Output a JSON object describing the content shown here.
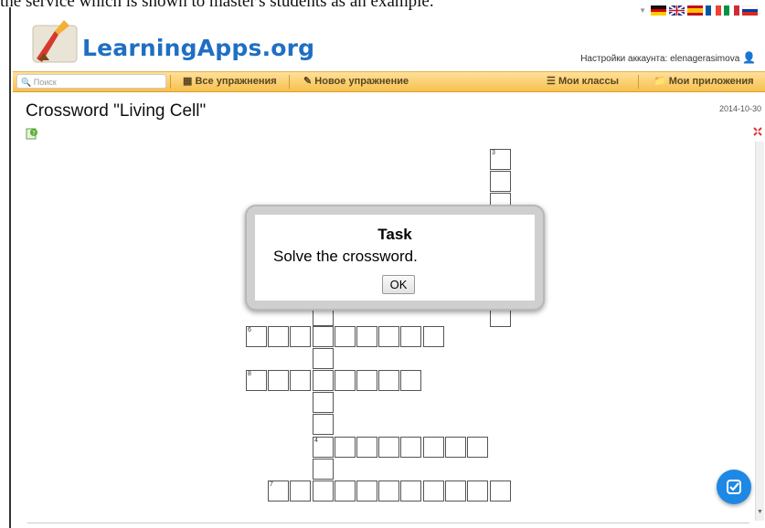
{
  "doc_text_above": "the service which is shown to master's students as an example.",
  "header": {
    "logo_text": "LearningApps.org",
    "account_label": "Настройки аккаунта: elenagerasimova"
  },
  "navbar": {
    "search_placeholder": "Поиск",
    "items": [
      {
        "label": "Все упражнения",
        "icon": "grid-icon"
      },
      {
        "label": "Новое упражнение",
        "icon": "pencil-icon"
      },
      {
        "label": "Мои классы",
        "icon": "list-icon"
      },
      {
        "label": "Мои приложения",
        "icon": "folder-icon"
      }
    ]
  },
  "app": {
    "title": "Crossword \"Living Cell\"",
    "date": "2014-10-30"
  },
  "crossword": {
    "clue_numbers": [
      "3",
      "6",
      "8",
      "4",
      "7"
    ]
  },
  "dialog": {
    "title": "Task",
    "message": "Solve the crossword.",
    "ok_label": "OK"
  },
  "colors": {
    "navbar": "#f6c14e",
    "logo_blue": "#1f6fc3",
    "check_button": "#1e88e5"
  }
}
